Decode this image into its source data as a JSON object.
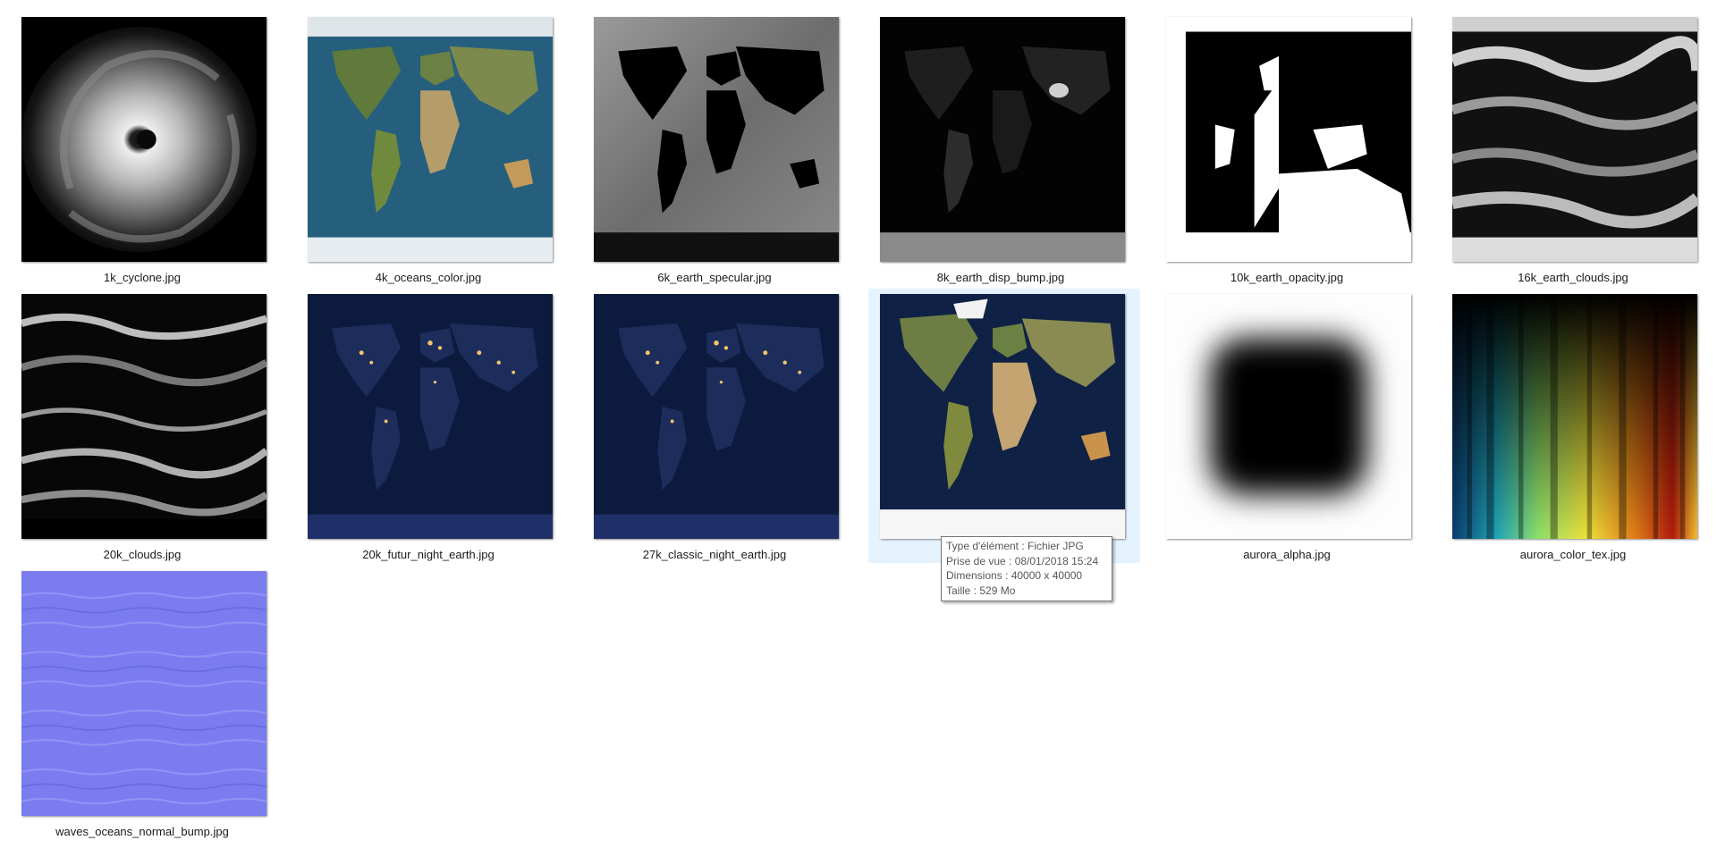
{
  "files": [
    {
      "name": "1k_cyclone.jpg",
      "icon": "cyclone-thumbnail"
    },
    {
      "name": "4k_oceans_color.jpg",
      "icon": "earth-color-thumbnail"
    },
    {
      "name": "6k_earth_specular.jpg",
      "icon": "earth-specular-thumbnail"
    },
    {
      "name": "8k_earth_disp_bump.jpg",
      "icon": "earth-bump-thumbnail"
    },
    {
      "name": "10k_earth_opacity.jpg",
      "icon": "earth-opacity-thumbnail"
    },
    {
      "name": "16k_earth_clouds.jpg",
      "icon": "earth-clouds-thumbnail"
    },
    {
      "name": "20k_clouds.jpg",
      "icon": "clouds-thumbnail"
    },
    {
      "name": "20k_futur_night_earth.jpg",
      "icon": "night-earth-thumbnail"
    },
    {
      "name": "27k_classic_night_earth.jpg",
      "icon": "night-earth-thumbnail"
    },
    {
      "name": "",
      "icon": "earth-color-thumbnail",
      "selected": true
    },
    {
      "name": "aurora_alpha.jpg",
      "icon": "alpha-gradient-thumbnail"
    },
    {
      "name": "aurora_color_tex.jpg",
      "icon": "aurora-color-thumbnail"
    },
    {
      "name": "waves_oceans_normal_bump.jpg",
      "icon": "normal-map-thumbnail"
    }
  ],
  "tooltip": {
    "type_line": "Type d'élément : Fichier JPG",
    "date_line": "Prise de vue : 08/01/2018 15:24",
    "dimensions_line": "Dimensions : 40000 x 40000",
    "size_line": "Taille : 529 Mo"
  },
  "colors": {
    "selection": "#e5f3ff",
    "ocean": "#1f5a78",
    "night": "#0c1a3d",
    "normal_map": "#7a7cf0"
  }
}
